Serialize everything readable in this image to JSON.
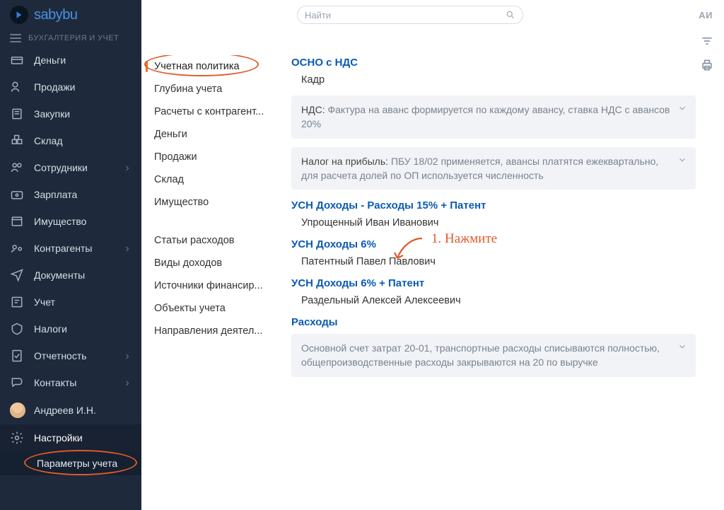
{
  "logo": "sabybu",
  "section_title": "БУХГАЛТЕРИЯ И УЧЕТ",
  "search": {
    "placeholder": "Найти"
  },
  "ai_label": "АИ",
  "nav": {
    "items": [
      {
        "label": "Деньги"
      },
      {
        "label": "Продажи"
      },
      {
        "label": "Закупки"
      },
      {
        "label": "Склад"
      },
      {
        "label": "Сотрудники"
      },
      {
        "label": "Зарплата"
      },
      {
        "label": "Имущество"
      },
      {
        "label": "Контрагенты"
      },
      {
        "label": "Документы"
      },
      {
        "label": "Учет"
      },
      {
        "label": "Налоги"
      },
      {
        "label": "Отчетность"
      },
      {
        "label": "Контакты"
      }
    ],
    "user": "Андреев И.Н.",
    "settings": "Настройки",
    "subitem": "Параметры учета"
  },
  "tabs": {
    "group1": [
      "Учетная политика",
      "Глубина учета",
      "Расчеты с контрагент...",
      "Деньги",
      "Продажи",
      "Склад",
      "Имущество"
    ],
    "group2": [
      "Статьи расходов",
      "Виды доходов",
      "Источники финансир...",
      "Объекты учета",
      "Направления деятел..."
    ]
  },
  "content": {
    "b1": {
      "title": "ОСНО с НДС",
      "sub": "Кадр"
    },
    "panel1": {
      "label": "НДС:",
      "text": "Фактура на аванс формируется по каждому авансу, ставка НДС с авансов 20%"
    },
    "panel2": {
      "label": "Налог на прибыль:",
      "text": "ПБУ 18/02 применяется, авансы платятся ежеквартально, для расчета долей по ОП используется численность"
    },
    "b2": {
      "title": "УСН Доходы - Расходы 15% + Патент",
      "sub": "Упрощенный Иван Иванович"
    },
    "b3": {
      "title": "УСН Доходы 6%",
      "sub": "Патентный Павел Павлович"
    },
    "b4": {
      "title": "УСН Доходы 6% + Патент",
      "sub": "Раздельный Алексей Алексеевич"
    },
    "b5": {
      "title": "Расходы"
    },
    "panel3": {
      "text": "Основной счет затрат 20-01, транспортные расходы списываются полностью, общепроизводственные расходы закрываются на 20 по выручке"
    }
  },
  "annotation": {
    "step1": "1. Нажмите"
  }
}
